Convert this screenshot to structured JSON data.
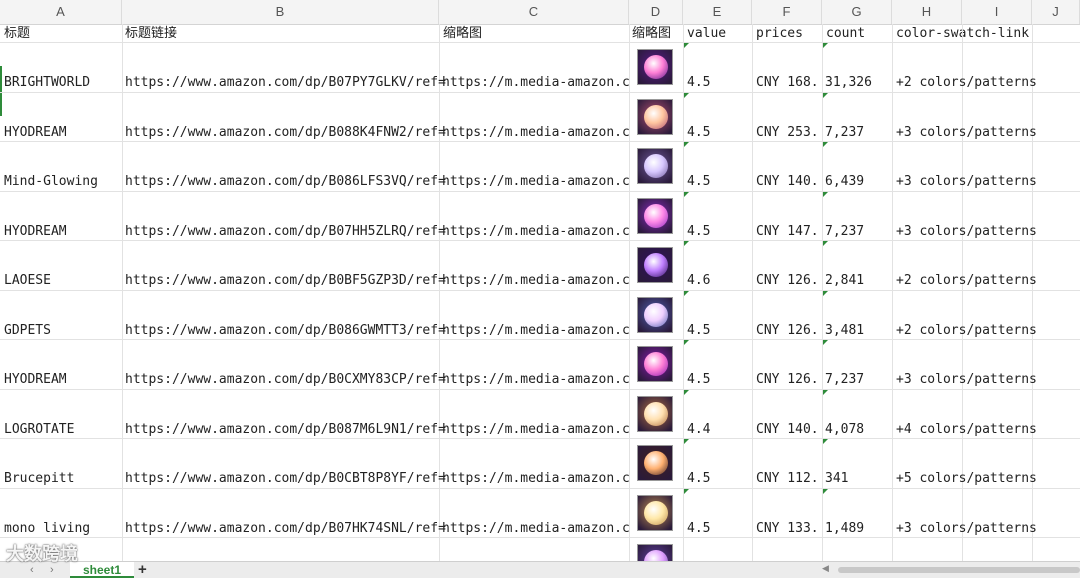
{
  "columns": [
    "A",
    "B",
    "C",
    "D",
    "E",
    "F",
    "G",
    "H",
    "I",
    "J"
  ],
  "headers": {
    "a": "标题",
    "b": "标题链接",
    "c": "缩略图",
    "d": "缩略图",
    "e": "value",
    "f": "prices",
    "g": "count",
    "h": "color-swatch-link"
  },
  "rows": [
    {
      "title": "BRIGHTWORLD",
      "link": "https://www.amazon.com/dp/B07PY7GLKV/ref=",
      "thumb": "https://m.media-amazon.c",
      "value": "4.5",
      "price": "CNY  168.",
      "count": "31,326",
      "swatch": "+2 colors/patterns"
    },
    {
      "title": "HYODREAM",
      "link": "https://www.amazon.com/dp/B088K4FNW2/ref=",
      "thumb": "https://m.media-amazon.c",
      "value": "4.5",
      "price": "CNY  253.",
      "count": "7,237",
      "swatch": "+3 colors/patterns"
    },
    {
      "title": "Mind-Glowing",
      "link": "https://www.amazon.com/dp/B086LFS3VQ/ref=",
      "thumb": "https://m.media-amazon.c",
      "value": "4.5",
      "price": "CNY  140.",
      "count": "6,439",
      "swatch": "+3 colors/patterns"
    },
    {
      "title": "HYODREAM",
      "link": "https://www.amazon.com/dp/B07HH5ZLRQ/ref=",
      "thumb": "https://m.media-amazon.c",
      "value": "4.5",
      "price": "CNY  147.",
      "count": "7,237",
      "swatch": "+3 colors/patterns"
    },
    {
      "title": "LAOESE",
      "link": "https://www.amazon.com/dp/B0BF5GZP3D/ref=",
      "thumb": "https://m.media-amazon.c",
      "value": "4.6",
      "price": "CNY  126.",
      "count": "2,841",
      "swatch": "+2 colors/patterns"
    },
    {
      "title": "GDPETS",
      "link": "https://www.amazon.com/dp/B086GWMTT3/ref=",
      "thumb": "https://m.media-amazon.c",
      "value": "4.5",
      "price": "CNY  126.",
      "count": "3,481",
      "swatch": "+2 colors/patterns"
    },
    {
      "title": "HYODREAM",
      "link": "https://www.amazon.com/dp/B0CXMY83CP/ref=",
      "thumb": "https://m.media-amazon.c",
      "value": "4.5",
      "price": "CNY  126.",
      "count": "7,237",
      "swatch": "+3 colors/patterns"
    },
    {
      "title": "LOGROTATE",
      "link": "https://www.amazon.com/dp/B087M6L9N1/ref=",
      "thumb": "https://m.media-amazon.c",
      "value": "4.4",
      "price": "CNY  140.",
      "count": "4,078",
      "swatch": "+4 colors/patterns"
    },
    {
      "title": "Brucepitt",
      "link": "https://www.amazon.com/dp/B0CBT8P8YF/ref=",
      "thumb": "https://m.media-amazon.c",
      "value": "4.5",
      "price": "CNY  112.",
      "count": "341",
      "swatch": "+5 colors/patterns"
    },
    {
      "title": "mono living",
      "link": "https://www.amazon.com/dp/B07HK74SNL/ref=",
      "thumb": "https://m.media-amazon.c",
      "value": "4.5",
      "price": "CNY  133.",
      "count": "1,489",
      "swatch": "+3 colors/patterns"
    }
  ],
  "thumb_colors": [
    [
      "#ff7fd6",
      "#5a1a8a"
    ],
    [
      "#ffc6a0",
      "#b05070"
    ],
    [
      "#d8c8ff",
      "#6e5a9a"
    ],
    [
      "#ff8ae8",
      "#8a2abf"
    ],
    [
      "#c080ff",
      "#301060"
    ],
    [
      "#f0d0ff",
      "#5060b0"
    ],
    [
      "#ff7fd6",
      "#8a1ab0"
    ],
    [
      "#ffe0b0",
      "#b07040"
    ],
    [
      "#ffb070",
      "#402020"
    ],
    [
      "#ffe8a8",
      "#c09050"
    ],
    [
      "#e0a0ff",
      "#6040a0"
    ]
  ],
  "sheet": {
    "tab": "sheet1",
    "add": "+"
  },
  "watermark": "大数跨境",
  "accent": "#2e8b3a"
}
